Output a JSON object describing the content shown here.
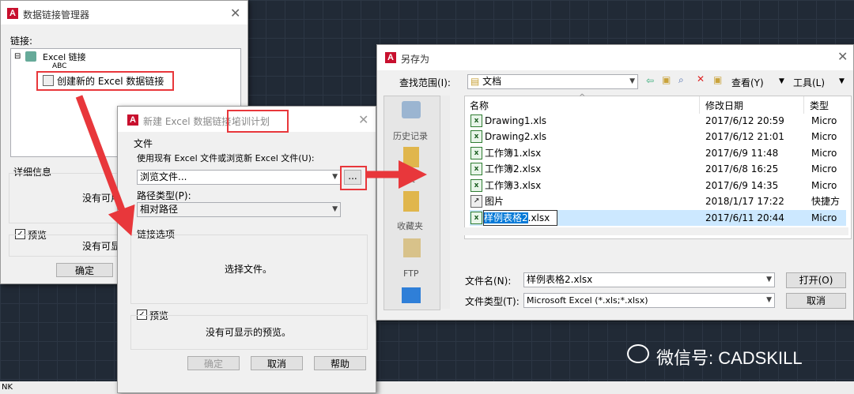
{
  "cmdline": {
    "text": "NK"
  },
  "link_mgr": {
    "title": "数据链接管理器",
    "links_label": "链接:",
    "tree_root": "Excel 链接",
    "tree_child": "ABC",
    "tree_new": "创建新的 Excel 数据链接",
    "details_label": "详细信息",
    "details_text": "没有可用",
    "preview_label": "预览",
    "preview_text": "没有可显",
    "ok": "确定"
  },
  "new_link": {
    "title": "新建 Excel 数据链接 -",
    "title_name": "培训计划",
    "file_group": "文件",
    "use_label": "使用现有 Excel 文件或浏览新 Excel 文件(U):",
    "browse_value": "浏览文件...",
    "browse_btn": "...",
    "path_type_label": "路径类型(P):",
    "path_type_value": "相对路径",
    "link_options": "链接选项",
    "select_file": "选择文件。",
    "preview_label": "预览",
    "preview_text": "没有可显示的预览。",
    "ok": "确定",
    "cancel": "取消",
    "help": "帮助"
  },
  "save_as": {
    "title": "另存为",
    "lookin_label": "查找范围(I):",
    "lookin_value": "文档",
    "view_label": "查看(Y)",
    "tools_label": "工具(L)",
    "places": [
      "历史记录",
      "文",
      "收藏夹",
      "FTP"
    ],
    "columns": {
      "name": "名称",
      "date": "修改日期",
      "type": "类型"
    },
    "files": [
      {
        "name": "Drawing1.xls",
        "date": "2017/6/12 20:59",
        "type": "Micro"
      },
      {
        "name": "Drawing2.xls",
        "date": "2017/6/12 21:01",
        "type": "Micro"
      },
      {
        "name": "工作簿1.xlsx",
        "date": "2017/6/9 11:48",
        "type": "Micro"
      },
      {
        "name": "工作簿2.xlsx",
        "date": "2017/6/8 16:25",
        "type": "Micro"
      },
      {
        "name": "工作簿3.xlsx",
        "date": "2017/6/9 14:35",
        "type": "Micro"
      },
      {
        "name": "图片",
        "date": "2018/1/17 17:22",
        "type": "快捷方"
      }
    ],
    "edit_selected": "样例表格2",
    "edit_rest": ".xlsx",
    "edit_date": "2017/6/11 20:44",
    "edit_type": "Micro",
    "filename_label": "文件名(N):",
    "filename_value": "样例表格2.xlsx",
    "filetype_label": "文件类型(T):",
    "filetype_value": "Microsoft Excel (*.xls;*.xlsx)",
    "open": "打开(O)",
    "cancel": "取消"
  },
  "watermark": "微信号: CADSKILL"
}
